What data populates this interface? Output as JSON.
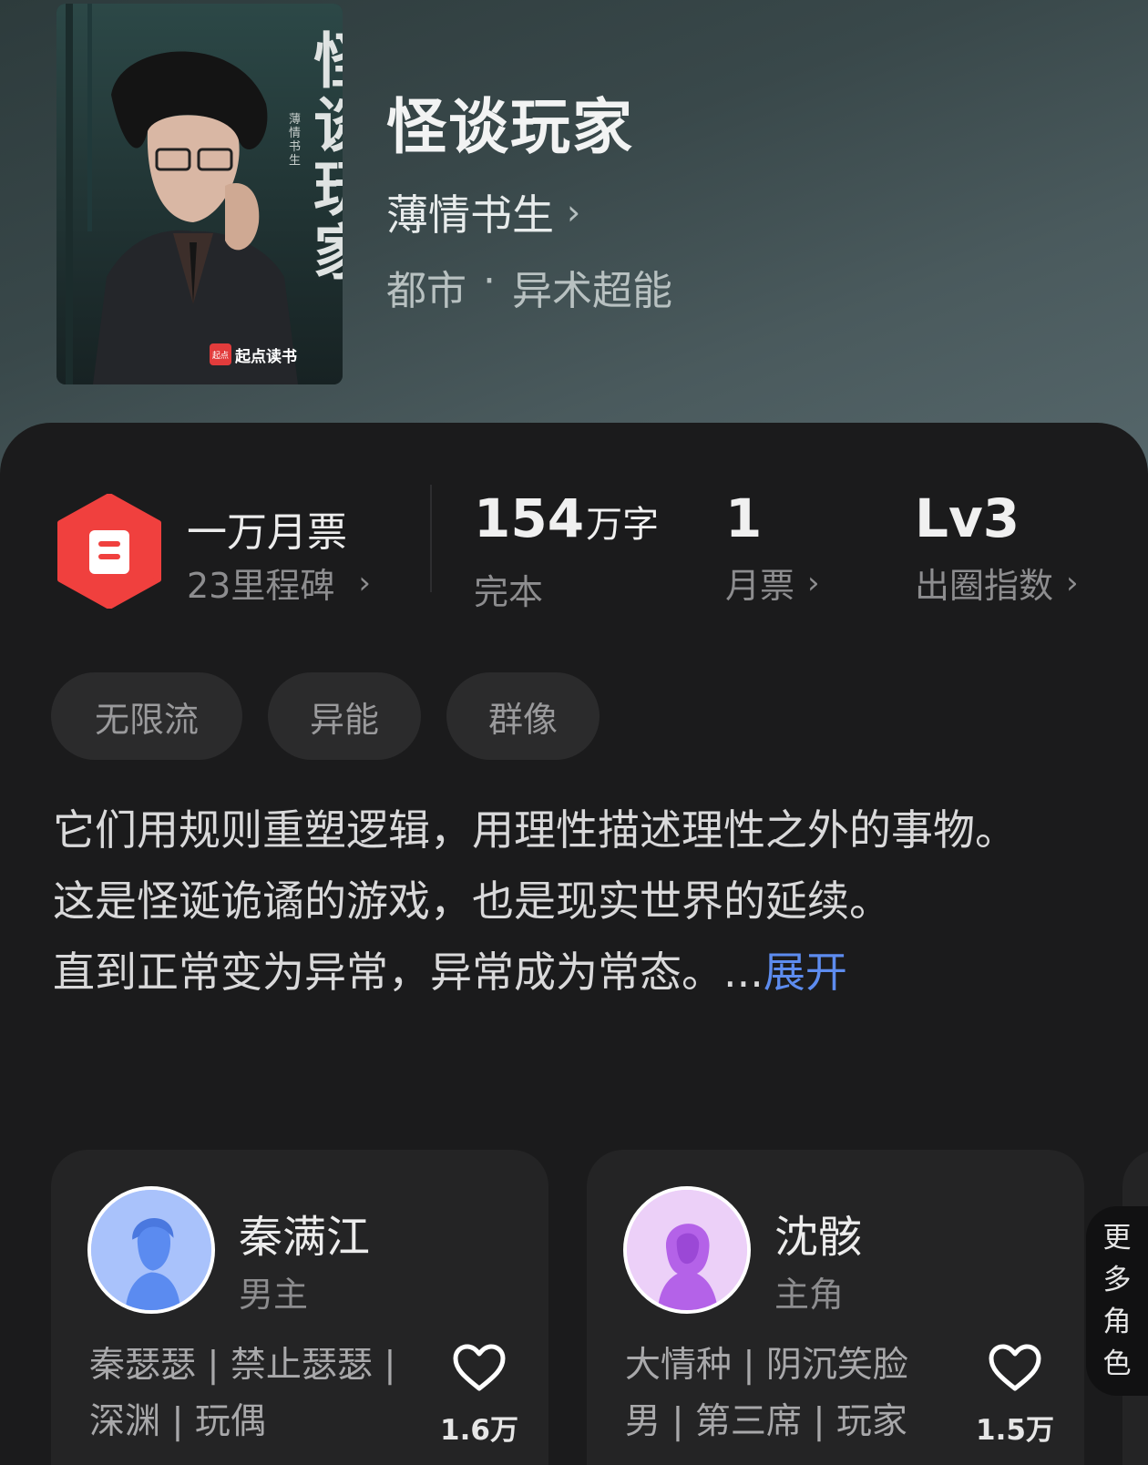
{
  "book": {
    "cover_title": "怪谈玩家",
    "cover_author": "薄情书生",
    "cover_publisher": "起点读书",
    "title": "怪谈玩家",
    "author": "薄情书生",
    "genre_main": "都市",
    "genre_separator": "·",
    "genre_sub": "异术超能"
  },
  "stats": {
    "ticket_title": "一万月票",
    "ticket_sub": "23里程碑",
    "words_value": "154",
    "words_unit": "万字",
    "words_label": "完本",
    "monthly_value": "1",
    "monthly_label": "月票",
    "level_value": "Lv3",
    "level_label": "出圈指数"
  },
  "tags": [
    "无限流",
    "异能",
    "群像"
  ],
  "description": {
    "line1": "它们用规则重塑逻辑，用理性描述理性之外的事物。",
    "line2": "这是怪诞诡谲的游戏，也是现实世界的延续。",
    "line3": "直到正常变为异常，异常成为常态。...",
    "expand_label": "展开"
  },
  "characters": [
    {
      "name": "秦满江",
      "role": "男主",
      "tags_line1": "秦瑟瑟 | 禁止瑟瑟 |",
      "tags_line2": "深渊 | 玩偶",
      "likes": "1.6万",
      "avatar_color": "#5b8bf0"
    },
    {
      "name": "沈骸",
      "role": "主角",
      "tags_line1": "大情种 | 阴沉笑脸",
      "tags_line2": "男 | 第三席 | 玩家",
      "likes": "1.5万",
      "avatar_color": "#b462e8"
    }
  ],
  "more_roles_label": "更多角色",
  "icons": {
    "author_chevron": "chevron-right-icon",
    "ticket": "monthly-ticket-badge-icon",
    "like": "heart-outline-icon"
  },
  "colors": {
    "accent_red": "#f0403e",
    "link_blue": "#5d8cef",
    "card_bg": "#242425",
    "page_bg": "#1b1b1c"
  }
}
